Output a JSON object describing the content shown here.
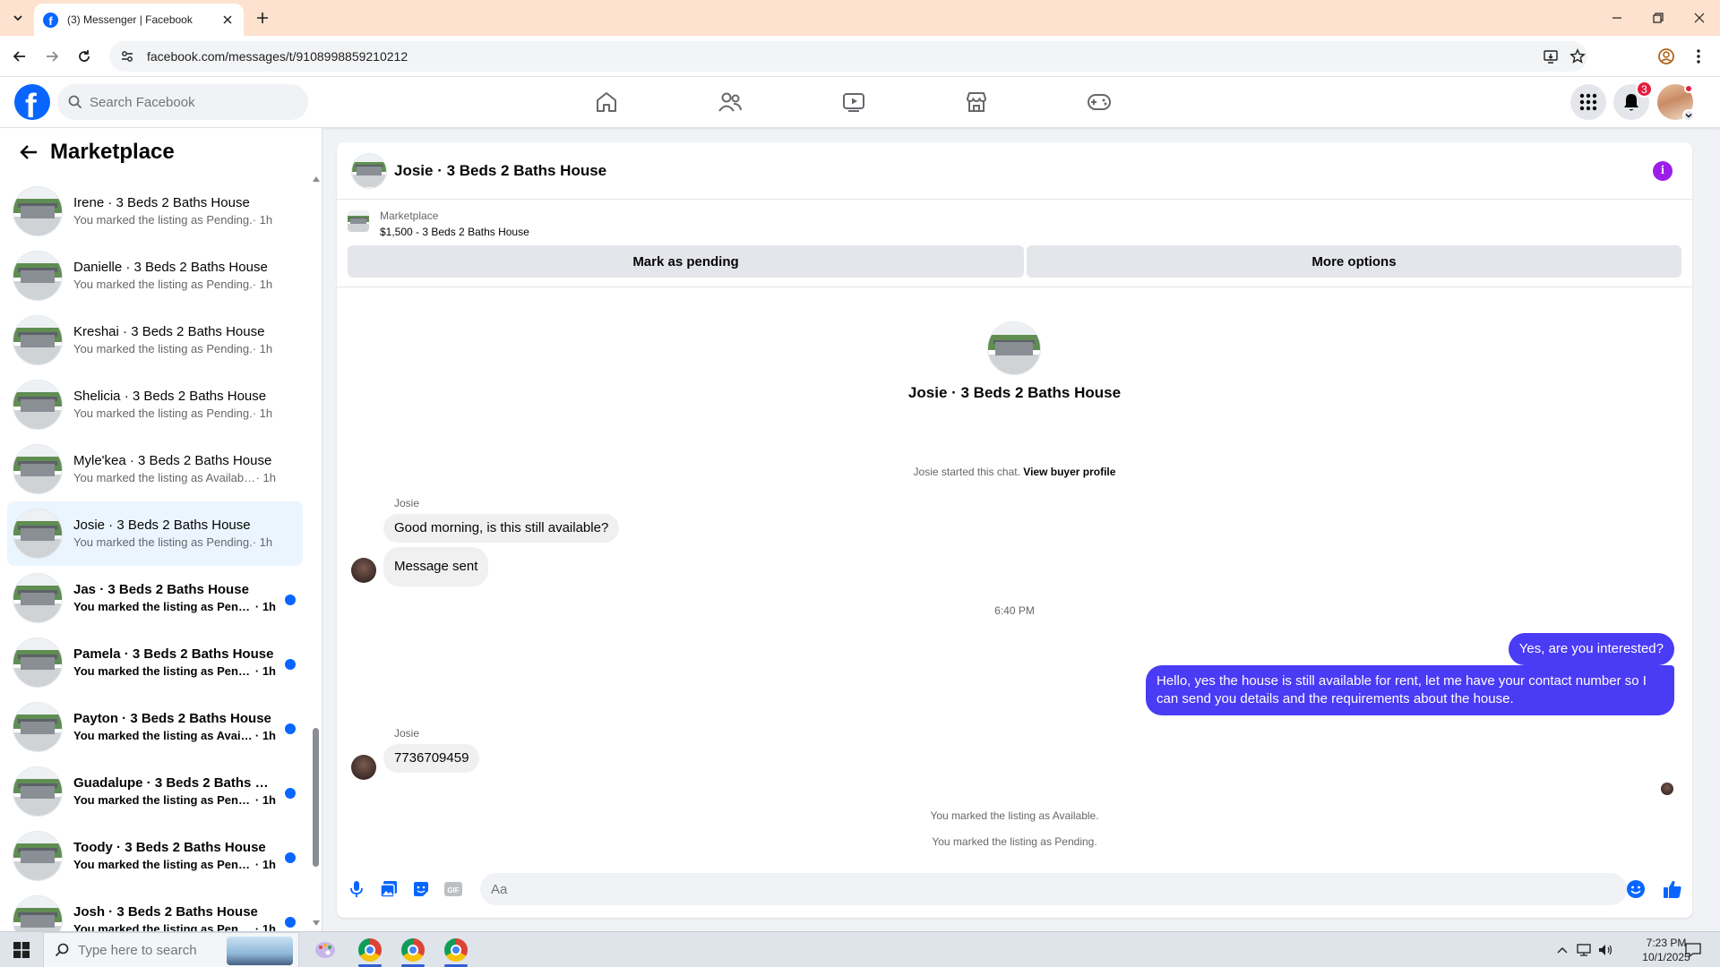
{
  "browser": {
    "tab_title": "(3) Messenger | Facebook",
    "url": "facebook.com/messages/t/9108998859210212"
  },
  "header": {
    "search_placeholder": "Search Facebook",
    "notification_count": "3",
    "brand_color": "#0866ff"
  },
  "sidebar": {
    "title": "Marketplace",
    "conversations": [
      {
        "name": "Irene · 3 Beds 2 Baths House",
        "sub": "You marked the listing as Pending.",
        "time": " · 1h",
        "unread": false,
        "active": false
      },
      {
        "name": "Danielle · 3 Beds 2 Baths House",
        "sub": "You marked the listing as Pending.",
        "time": " · 1h",
        "unread": false,
        "active": false
      },
      {
        "name": "Kreshai · 3 Beds 2 Baths House",
        "sub": "You marked the listing as Pending.",
        "time": " · 1h",
        "unread": false,
        "active": false
      },
      {
        "name": "Shelicia · 3 Beds 2 Baths House",
        "sub": "You marked the listing as Pending.",
        "time": " · 1h",
        "unread": false,
        "active": false
      },
      {
        "name": "Myle'kea · 3 Beds 2 Baths House",
        "sub": "You marked the listing as Available.",
        "time": " · 1h",
        "unread": false,
        "active": false
      },
      {
        "name": "Josie · 3 Beds 2 Baths House",
        "sub": "You marked the listing as Pending.",
        "time": " · 1h",
        "unread": false,
        "active": true
      },
      {
        "name": "Jas · 3 Beds 2 Baths House",
        "sub": "You marked the listing as Pendi...",
        "time": " · 1h",
        "unread": true,
        "active": false
      },
      {
        "name": "Pamela · 3 Beds 2 Baths House",
        "sub": "You marked the listing as Pendi...",
        "time": " · 1h",
        "unread": true,
        "active": false
      },
      {
        "name": "Payton · 3 Beds 2 Baths House",
        "sub": "You marked the listing as Availa...",
        "time": " · 1h",
        "unread": true,
        "active": false
      },
      {
        "name": "Guadalupe · 3 Beds 2 Baths Ho...",
        "sub": "You marked the listing as Pendi...",
        "time": " · 1h",
        "unread": true,
        "active": false
      },
      {
        "name": "Toody · 3 Beds 2 Baths House",
        "sub": "You marked the listing as Pendi...",
        "time": " · 1h",
        "unread": true,
        "active": false
      },
      {
        "name": "Josh · 3 Beds 2 Baths House",
        "sub": "You marked the listing as Pendi...",
        "time": " · 1h",
        "unread": true,
        "active": false
      }
    ]
  },
  "chat": {
    "title": "Josie · 3 Beds 2 Baths House",
    "listing_label": "Marketplace",
    "listing_price": "$1,500 - 3 Beds 2 Baths House",
    "mark_pending_label": "Mark as pending",
    "more_options_label": "More options",
    "hero_title": "Josie · 3 Beds 2 Baths House",
    "started_text": "Josie started this chat. ",
    "view_profile_label": "View buyer profile",
    "sender_1": "Josie",
    "msg_in_1": "Good morning, is this still available?",
    "msg_in_2": "Message sent",
    "timestamp": "6:40 PM",
    "msg_out_1": "Yes, are you interested?",
    "msg_out_2": "Hello, yes the house is still available for rent, let me have your contact number so I can send you details and the requirements about the house.",
    "sender_2": "Josie",
    "msg_in_3": "7736709459",
    "sys_1": "You marked the listing as Available.",
    "sys_2": "You marked the listing as Pending.",
    "composer_placeholder": "Aa",
    "outgoing_color": "#4a3bf5"
  },
  "taskbar": {
    "search_placeholder": "Type here to search",
    "time": "7:23 PM",
    "date": "10/1/2025"
  }
}
